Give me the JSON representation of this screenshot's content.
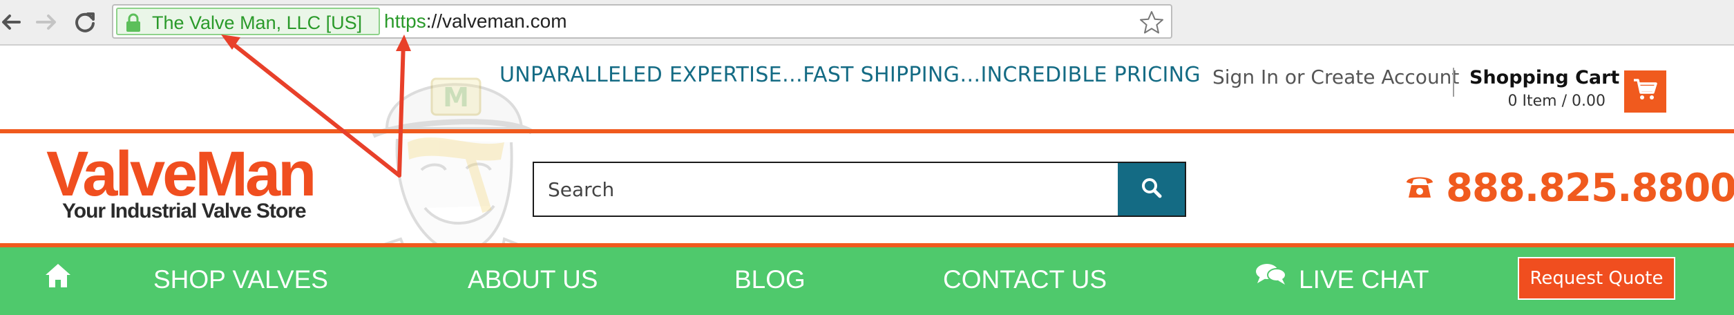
{
  "browser": {
    "ev_name": "The Valve Man, LLC [US]",
    "url_scheme": "https",
    "url_rest": "://valveman.com",
    "icons": [
      "back-arrow-icon",
      "forward-arrow-icon",
      "reload-icon",
      "lock-icon",
      "star-icon"
    ]
  },
  "header": {
    "tagline": "UNPARALLELED EXPERTISE…FAST SHIPPING…INCREDIBLE PRICING",
    "signin": "Sign In or Create Account",
    "cart_title": "Shopping Cart",
    "cart_count": "0 Item / 0.00"
  },
  "logo": {
    "main": "ValveMan",
    "sub": "Your Industrial Valve Store"
  },
  "search": {
    "placeholder": "Search"
  },
  "phone": {
    "number": "888.825.8800"
  },
  "nav": {
    "items": [
      {
        "label": "SHOP VALVES"
      },
      {
        "label": "ABOUT US"
      },
      {
        "label": "BLOG"
      },
      {
        "label": "CONTACT US"
      },
      {
        "label": "LIVE CHAT"
      }
    ],
    "quote_label": "Request Quote"
  },
  "colors": {
    "brand_orange": "#f05a1e",
    "brand_teal": "#146b84",
    "nav_green": "#4fc96c",
    "ev_green": "#2a9a2a",
    "annotation_red": "#e8402a"
  }
}
